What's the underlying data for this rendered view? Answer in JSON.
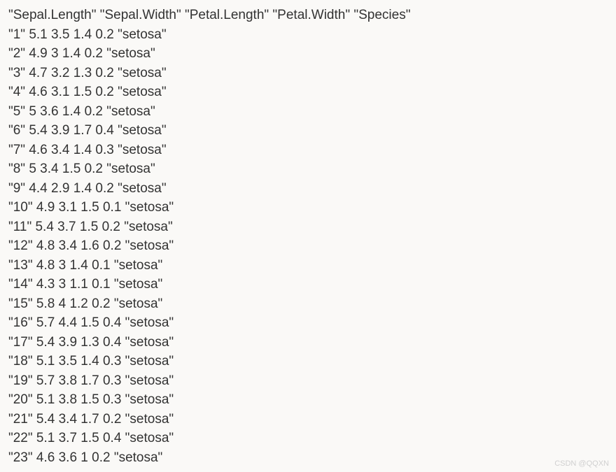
{
  "header": "\"Sepal.Length\" \"Sepal.Width\" \"Petal.Length\" \"Petal.Width\" \"Species\"",
  "rows": [
    "\"1\" 5.1 3.5 1.4 0.2 \"setosa\"",
    "\"2\" 4.9 3 1.4 0.2 \"setosa\"",
    "\"3\" 4.7 3.2 1.3 0.2 \"setosa\"",
    "\"4\" 4.6 3.1 1.5 0.2 \"setosa\"",
    "\"5\" 5 3.6 1.4 0.2 \"setosa\"",
    "\"6\" 5.4 3.9 1.7 0.4 \"setosa\"",
    "\"7\" 4.6 3.4 1.4 0.3 \"setosa\"",
    "\"8\" 5 3.4 1.5 0.2 \"setosa\"",
    "\"9\" 4.4 2.9 1.4 0.2 \"setosa\"",
    "\"10\" 4.9 3.1 1.5 0.1 \"setosa\"",
    "\"11\" 5.4 3.7 1.5 0.2 \"setosa\"",
    "\"12\" 4.8 3.4 1.6 0.2 \"setosa\"",
    "\"13\" 4.8 3 1.4 0.1 \"setosa\"",
    "\"14\" 4.3 3 1.1 0.1 \"setosa\"",
    "\"15\" 5.8 4 1.2 0.2 \"setosa\"",
    "\"16\" 5.7 4.4 1.5 0.4 \"setosa\"",
    "\"17\" 5.4 3.9 1.3 0.4 \"setosa\"",
    "\"18\" 5.1 3.5 1.4 0.3 \"setosa\"",
    "\"19\" 5.7 3.8 1.7 0.3 \"setosa\"",
    "\"20\" 5.1 3.8 1.5 0.3 \"setosa\"",
    "\"21\" 5.4 3.4 1.7 0.2 \"setosa\"",
    "\"22\" 5.1 3.7 1.5 0.4 \"setosa\"",
    "\"23\" 4.6 3.6 1 0.2 \"setosa\""
  ],
  "watermark": "CSDN @QQXN",
  "chart_data": {
    "type": "table",
    "columns": [
      "Sepal.Length",
      "Sepal.Width",
      "Petal.Length",
      "Petal.Width",
      "Species"
    ],
    "index": [
      1,
      2,
      3,
      4,
      5,
      6,
      7,
      8,
      9,
      10,
      11,
      12,
      13,
      14,
      15,
      16,
      17,
      18,
      19,
      20,
      21,
      22,
      23
    ],
    "data": [
      [
        5.1,
        3.5,
        1.4,
        0.2,
        "setosa"
      ],
      [
        4.9,
        3.0,
        1.4,
        0.2,
        "setosa"
      ],
      [
        4.7,
        3.2,
        1.3,
        0.2,
        "setosa"
      ],
      [
        4.6,
        3.1,
        1.5,
        0.2,
        "setosa"
      ],
      [
        5.0,
        3.6,
        1.4,
        0.2,
        "setosa"
      ],
      [
        5.4,
        3.9,
        1.7,
        0.4,
        "setosa"
      ],
      [
        4.6,
        3.4,
        1.4,
        0.3,
        "setosa"
      ],
      [
        5.0,
        3.4,
        1.5,
        0.2,
        "setosa"
      ],
      [
        4.4,
        2.9,
        1.4,
        0.2,
        "setosa"
      ],
      [
        4.9,
        3.1,
        1.5,
        0.1,
        "setosa"
      ],
      [
        5.4,
        3.7,
        1.5,
        0.2,
        "setosa"
      ],
      [
        4.8,
        3.4,
        1.6,
        0.2,
        "setosa"
      ],
      [
        4.8,
        3.0,
        1.4,
        0.1,
        "setosa"
      ],
      [
        4.3,
        3.0,
        1.1,
        0.1,
        "setosa"
      ],
      [
        5.8,
        4.0,
        1.2,
        0.2,
        "setosa"
      ],
      [
        5.7,
        4.4,
        1.5,
        0.4,
        "setosa"
      ],
      [
        5.4,
        3.9,
        1.3,
        0.4,
        "setosa"
      ],
      [
        5.1,
        3.5,
        1.4,
        0.3,
        "setosa"
      ],
      [
        5.7,
        3.8,
        1.7,
        0.3,
        "setosa"
      ],
      [
        5.1,
        3.8,
        1.5,
        0.3,
        "setosa"
      ],
      [
        5.4,
        3.4,
        1.7,
        0.2,
        "setosa"
      ],
      [
        5.1,
        3.7,
        1.5,
        0.4,
        "setosa"
      ],
      [
        4.6,
        3.6,
        1.0,
        0.2,
        "setosa"
      ]
    ]
  }
}
